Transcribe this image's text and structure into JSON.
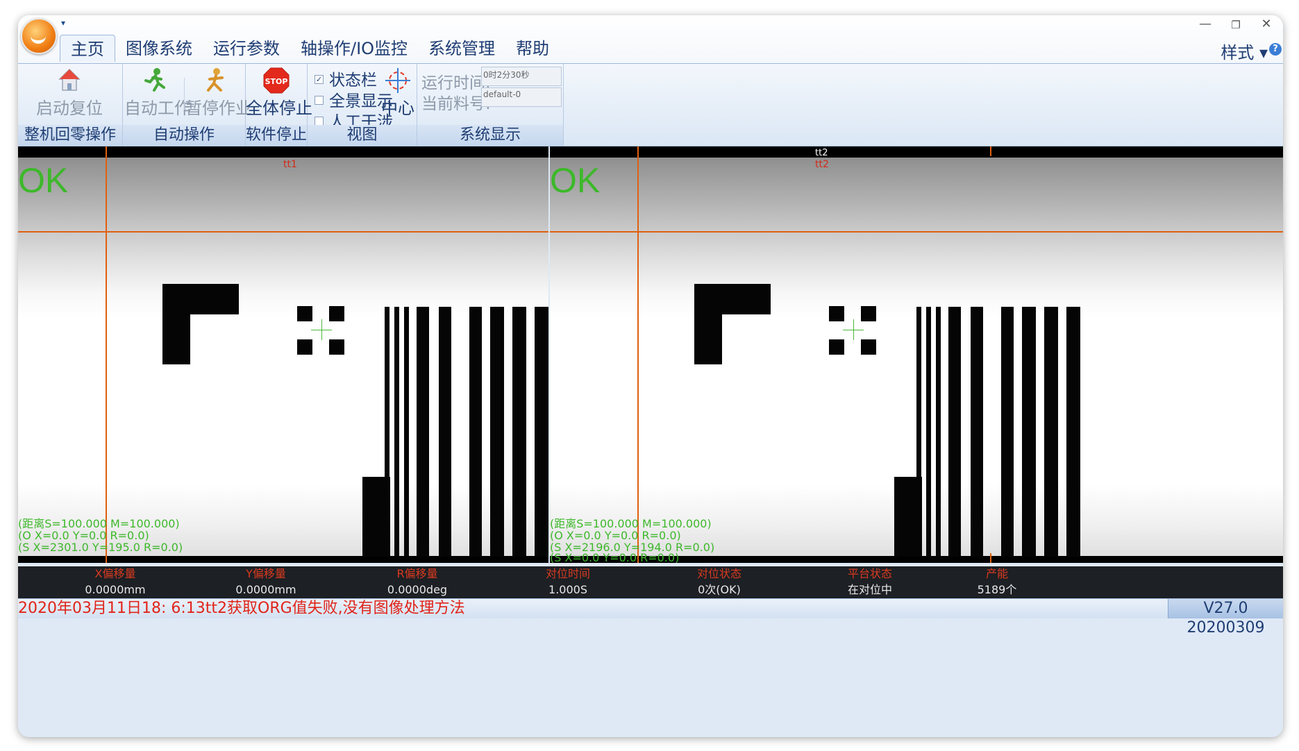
{
  "window": {
    "qat_arrow": "▾",
    "controls": {
      "minimize": "—",
      "restore": "❐",
      "close": "✕"
    }
  },
  "menu": {
    "tabs": [
      {
        "label": "主页",
        "active": true
      },
      {
        "label": "图像系统"
      },
      {
        "label": "运行参数"
      },
      {
        "label": "轴操作/IO监控"
      },
      {
        "label": "系统管理"
      },
      {
        "label": "帮助"
      }
    ],
    "style_menu": "样式 ▾",
    "help_icon": "?"
  },
  "ribbon": {
    "home_group": {
      "label": "整机回零操作",
      "reset_button": "启动复位"
    },
    "auto_group": {
      "label": "自动操作",
      "auto_work": "自动工作",
      "pause_work": "暂停作业"
    },
    "stop_group": {
      "label": "软件停止",
      "stop_all": "全体停止",
      "stop_icon_text": "STOP"
    },
    "view_group": {
      "label": "视图",
      "checkboxes": [
        {
          "label": "状态栏",
          "checked": true
        },
        {
          "label": "全景显示",
          "checked": false
        },
        {
          "label": "人工干涉",
          "checked": false
        }
      ],
      "center_button": "中心"
    },
    "system_group": {
      "label": "系统显示",
      "run_time_label": "运行时间:",
      "run_time_value": "0时2分30秒",
      "material_label": "当前料号:",
      "material_value": "default-0"
    }
  },
  "panes": [
    {
      "result": "OK",
      "camera": "tt1",
      "info": [
        "(距离S=100.000 M=100.000)",
        "(O X=0.0 Y=0.0 R=0.0)",
        "(S X=2301.0 Y=195.0 R=0.0)"
      ]
    },
    {
      "result": "OK",
      "camera": "tt2",
      "camera_top": "tt2",
      "info": [
        "(距离S=100.000 M=100.000)",
        "(O X=0.0 Y=0.0 R=0.0)",
        "(S X=2196.0 Y=194.0 R=0.0)",
        "(S X=0.0 Y=0.0 R=0.0)"
      ]
    }
  ],
  "stats": [
    {
      "key": "X偏移量",
      "value": "0.0000mm"
    },
    {
      "key": "Y偏移量",
      "value": "0.0000mm"
    },
    {
      "key": "R偏移量",
      "value": "0.0000deg"
    },
    {
      "key": "对位时间",
      "value": "1.000S"
    },
    {
      "key": "对位状态",
      "value": "0次(OK)"
    },
    {
      "key": "平台状态",
      "value": "在对位中"
    },
    {
      "key": "产能",
      "value": "5189个"
    }
  ],
  "status_bar": {
    "message": "2020年03月11日18: 6:13tt2获取ORG值失败,没有图像处理方法",
    "version": "V27.0 20200309"
  },
  "colors": {
    "ok_green": "#3db82a",
    "guide_orange": "#e06010",
    "alert_red": "#e0241a",
    "ribbon_blue": "#1f3d73"
  }
}
